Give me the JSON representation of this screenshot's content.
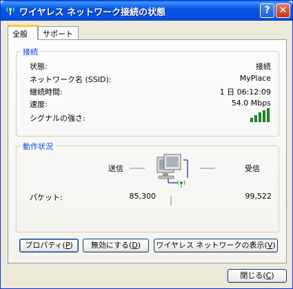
{
  "window": {
    "title": "ワイヤレス ネットワーク接続の状態",
    "help_glyph": "?",
    "close_glyph": "✕"
  },
  "tabs": [
    {
      "label": "全般"
    },
    {
      "label": "サポート"
    }
  ],
  "connection": {
    "group_title": "接続",
    "status_label": "状態:",
    "status_value": "接続",
    "ssid_label": "ネットワーク名 (SSID):",
    "ssid_value": "MyPlace",
    "duration_label": "継続時間:",
    "duration_value": "1 日 06:12:09",
    "speed_label": "速度:",
    "speed_value": "54.0 Mbps",
    "signal_label": "シグナルの強さ:",
    "signal_level": 5,
    "signal_max": 5
  },
  "activity": {
    "group_title": "動作状況",
    "sent_label": "送信",
    "received_label": "受信",
    "packets_label": "パケット:",
    "packets_sent": "85,300",
    "packets_received": "99,522",
    "colors": {
      "signal_green": "#1d9a2a"
    }
  },
  "buttons": {
    "properties": {
      "text": "プロパティ(",
      "key": "P",
      "end": ")"
    },
    "disable": {
      "text": "無効にする(",
      "key": "D",
      "end": ")"
    },
    "view_networks": {
      "text": "ワイヤレス ネットワークの表示(",
      "key": "V",
      "end": ")"
    },
    "close": {
      "text": "閉じる(",
      "key": "C",
      "end": ")"
    }
  }
}
